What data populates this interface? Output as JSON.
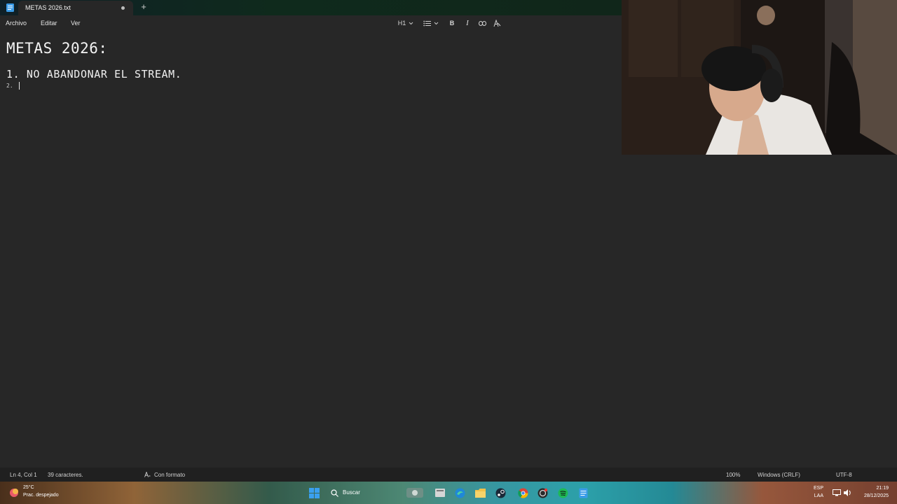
{
  "titlebar": {
    "tab_title": "METAS 2026.txt",
    "new_tab_label": "+"
  },
  "menu": {
    "items": [
      "Archivo",
      "Editar",
      "Ver"
    ]
  },
  "toolbar": {
    "heading_label": "H1",
    "bold_label": "B",
    "italic_label": "I"
  },
  "document": {
    "heading": "METAS 2026:",
    "line1": "1. NO ABANDONAR EL STREAM.",
    "line2": "2."
  },
  "status": {
    "position": "Ln 4, Col 1",
    "chars": "39 caracteres.",
    "format": "Con formato",
    "zoom": "100%",
    "line_ending": "Windows (CRLF)",
    "encoding": "UTF-8"
  },
  "taskbar": {
    "weather_temp": "25°C",
    "weather_desc": "Prac. despejado",
    "search_label": "Buscar",
    "lang_top": "ESP",
    "lang_bottom": "LAA",
    "time": "21:19",
    "date": "28/12/2025"
  },
  "colors": {
    "editor_bg": "#272727",
    "statusbar_bg": "#202020",
    "windows_blue": "#3a9ce8",
    "spotify_green": "#1db954"
  },
  "icons": [
    "notepad-icon",
    "chevron-down-icon",
    "list-icon",
    "link-icon",
    "clear-format-icon",
    "format-icon",
    "windows-start-icon",
    "search-icon",
    "file-explorer-icon",
    "edge-icon",
    "steam-icon",
    "chrome-icon",
    "spotify-icon",
    "notepad-taskbar-icon"
  ]
}
